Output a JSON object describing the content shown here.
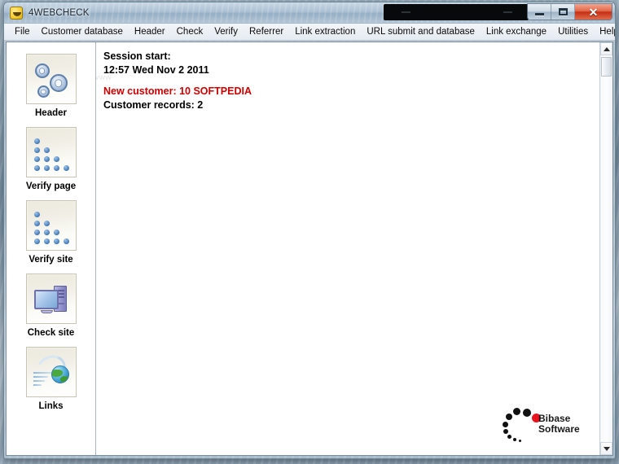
{
  "window": {
    "title": "4WEBCHECK",
    "app_icon": "app-logo-icon",
    "controls": {
      "minimize_label": "–",
      "maximize_label": "❐",
      "close_label": "✕"
    }
  },
  "menu": {
    "items": [
      {
        "label": "File"
      },
      {
        "label": "Customer database"
      },
      {
        "label": "Header"
      },
      {
        "label": "Check"
      },
      {
        "label": "Verify"
      },
      {
        "label": "Referrer"
      },
      {
        "label": "Link extraction"
      },
      {
        "label": "URL submit and database"
      },
      {
        "label": "Link exchange"
      },
      {
        "label": "Utilities"
      },
      {
        "label": "Help"
      }
    ]
  },
  "sidebar": {
    "items": [
      {
        "label": "Header",
        "icon": "gears-icon"
      },
      {
        "label": "Verify page",
        "icon": "dots-pyramid-icon"
      },
      {
        "label": "Verify site",
        "icon": "dots-pyramid-icon"
      },
      {
        "label": "Check site",
        "icon": "computer-icon"
      },
      {
        "label": "Links",
        "icon": "globe-links-icon"
      }
    ]
  },
  "content": {
    "watermark": "www",
    "log": [
      {
        "text": "Session start:",
        "style": "normal"
      },
      {
        "text": "12:57 Wed Nov 2 2011",
        "style": "normal"
      },
      {
        "text": "",
        "style": "gap"
      },
      {
        "text": "New customer: 10 SOFTPEDIA",
        "style": "highlight"
      },
      {
        "text": "Customer records: 2",
        "style": "normal"
      }
    ]
  },
  "brand": {
    "line1": "Bibase",
    "line2": "Software"
  },
  "colors": {
    "highlight_red": "#cc0000",
    "logo_red": "#e8141e",
    "close_button": "#c62f14",
    "text": "#000000"
  }
}
